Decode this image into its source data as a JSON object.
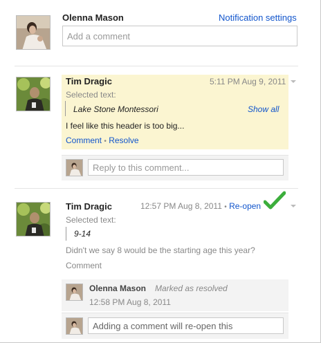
{
  "header": {
    "user_name": "Olenna Mason",
    "notification_settings": "Notification settings",
    "comment_placeholder": "Add a comment"
  },
  "thread1": {
    "author": "Tim Dragic",
    "timestamp": "5:11 PM Aug 9, 2011",
    "selected_text_label": "Selected text:",
    "selected_text": "Lake Stone Montessori",
    "show_all": "Show all",
    "body": "I feel like this header is too big...",
    "comment_link": "Comment",
    "separator": "•",
    "resolve_link": "Resolve",
    "reply_placeholder": "Reply to this comment...",
    "background_color": "#fbf5d1"
  },
  "thread2": {
    "author": "Tim Dragic",
    "timestamp": "12:57 PM Aug 8, 2011",
    "separator": "•",
    "reopen_link": "Re-open",
    "status_icon": "checkmark-icon",
    "selected_text_label": "Selected text:",
    "selected_text": "9-14",
    "body": "Didn't we say 8 would be the starting age this year?",
    "comment_link": "Comment",
    "reply": {
      "author": "Olenna Mason",
      "status": "Marked as resolved",
      "timestamp": "12:58 PM Aug 8, 2011"
    },
    "reopen_placeholder": "Adding a comment will re-open this"
  },
  "colors": {
    "link": "#1155cc",
    "check_green": "#3cae3c",
    "resolved_background": "#f3f3f3"
  }
}
